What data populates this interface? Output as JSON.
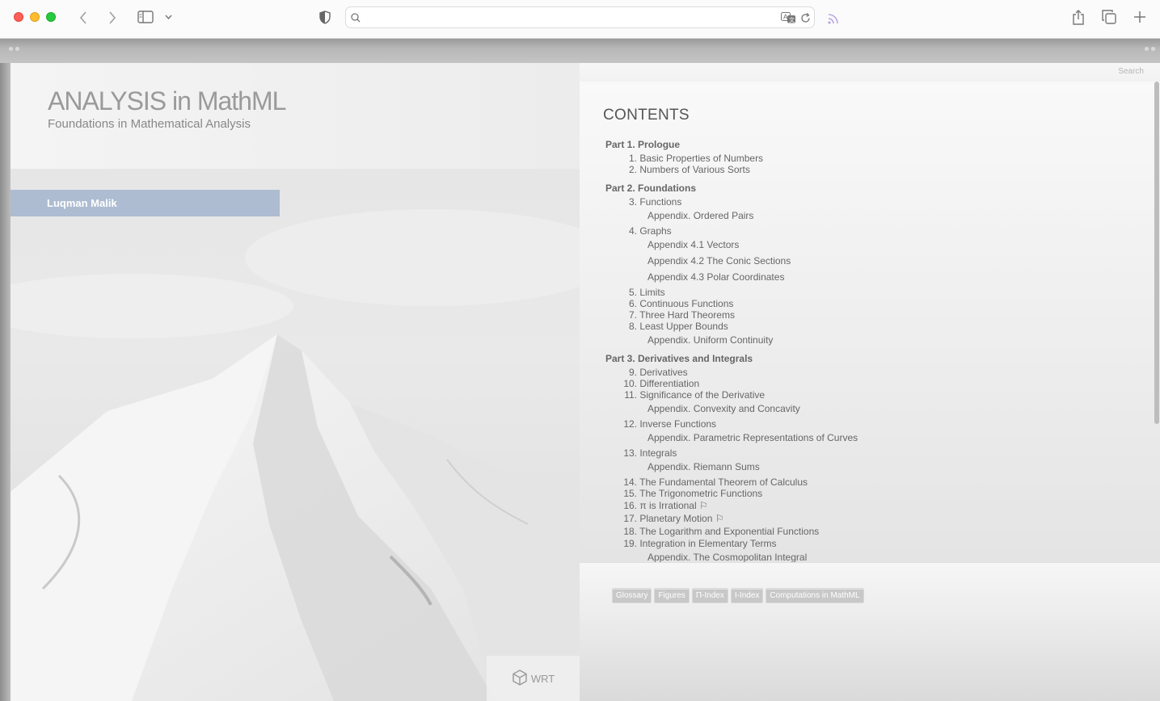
{
  "browser": {
    "address_value": "",
    "icons": [
      "back-icon",
      "forward-icon",
      "sidebar-icon",
      "shield-icon",
      "search-icon",
      "translate-icon",
      "reload-icon",
      "reader-icon",
      "share-icon",
      "tabs-icon",
      "new-tab-icon"
    ]
  },
  "book": {
    "title": "ANALYSIS in MathML",
    "subtitle": "Foundations in Mathematical Analysis",
    "author": "Luqman Malik",
    "publisher": "WRT"
  },
  "search": {
    "label": "Search"
  },
  "contents": {
    "title": "CONTENTS",
    "entries": [
      {
        "kind": "part",
        "text": "Part 1.  Prologue"
      },
      {
        "kind": "ch",
        "num": "1.",
        "text": "Basic Properties of Numbers"
      },
      {
        "kind": "ch",
        "num": "2.",
        "text": "Numbers of Various Sorts"
      },
      {
        "kind": "part",
        "text": "Part 2.  Foundations"
      },
      {
        "kind": "ch",
        "num": "3.",
        "text": "Functions"
      },
      {
        "kind": "app",
        "text": "Appendix. Ordered Pairs"
      },
      {
        "kind": "ch",
        "num": "4.",
        "text": "Graphs"
      },
      {
        "kind": "app",
        "text": "Appendix 4.1 Vectors"
      },
      {
        "kind": "app",
        "text": "Appendix 4.2 The Conic Sections"
      },
      {
        "kind": "app",
        "text": "Appendix 4.3 Polar Coordinates"
      },
      {
        "kind": "ch",
        "num": "5.",
        "text": "Limits"
      },
      {
        "kind": "ch",
        "num": "6.",
        "text": "Continuous Functions"
      },
      {
        "kind": "ch",
        "num": "7.",
        "text": "Three Hard Theorems"
      },
      {
        "kind": "ch",
        "num": "8.",
        "text": "Least Upper Bounds"
      },
      {
        "kind": "app",
        "text": "Appendix. Uniform Continuity"
      },
      {
        "kind": "part",
        "text": "Part 3.  Derivatives and Integrals"
      },
      {
        "kind": "ch",
        "num": "9.",
        "text": "Derivatives"
      },
      {
        "kind": "ch",
        "num": "10.",
        "text": "Differentiation"
      },
      {
        "kind": "ch",
        "num": "11.",
        "text": "Significance of the Derivative"
      },
      {
        "kind": "app",
        "text": "Appendix. Convexity and Concavity"
      },
      {
        "kind": "ch",
        "num": "12.",
        "text": "Inverse Functions"
      },
      {
        "kind": "app",
        "text": "Appendix. Parametric Representations of Curves"
      },
      {
        "kind": "ch",
        "num": "13.",
        "text": "Integrals"
      },
      {
        "kind": "app",
        "text": "Appendix. Riemann Sums"
      },
      {
        "kind": "ch",
        "num": "14.",
        "text": "The Fundamental Theorem of Calculus"
      },
      {
        "kind": "ch",
        "num": "15.",
        "text": "The Trigonometric Functions"
      },
      {
        "kind": "ch",
        "num": "16.",
        "text": "π is Irrational ⚐"
      },
      {
        "kind": "ch",
        "num": "17.",
        "text": "Planetary Motion ⚐"
      },
      {
        "kind": "ch",
        "num": "18.",
        "text": "The Logarithm and Exponential Functions"
      },
      {
        "kind": "ch",
        "num": "19.",
        "text": "Integration in Elementary Terms"
      },
      {
        "kind": "app",
        "text": "Appendix. The Cosmopolitan Integral"
      }
    ]
  },
  "bottom_links": [
    "Glossary",
    "Figures",
    "Π-Index",
    "Ι-Index",
    "Computations in MathML"
  ]
}
